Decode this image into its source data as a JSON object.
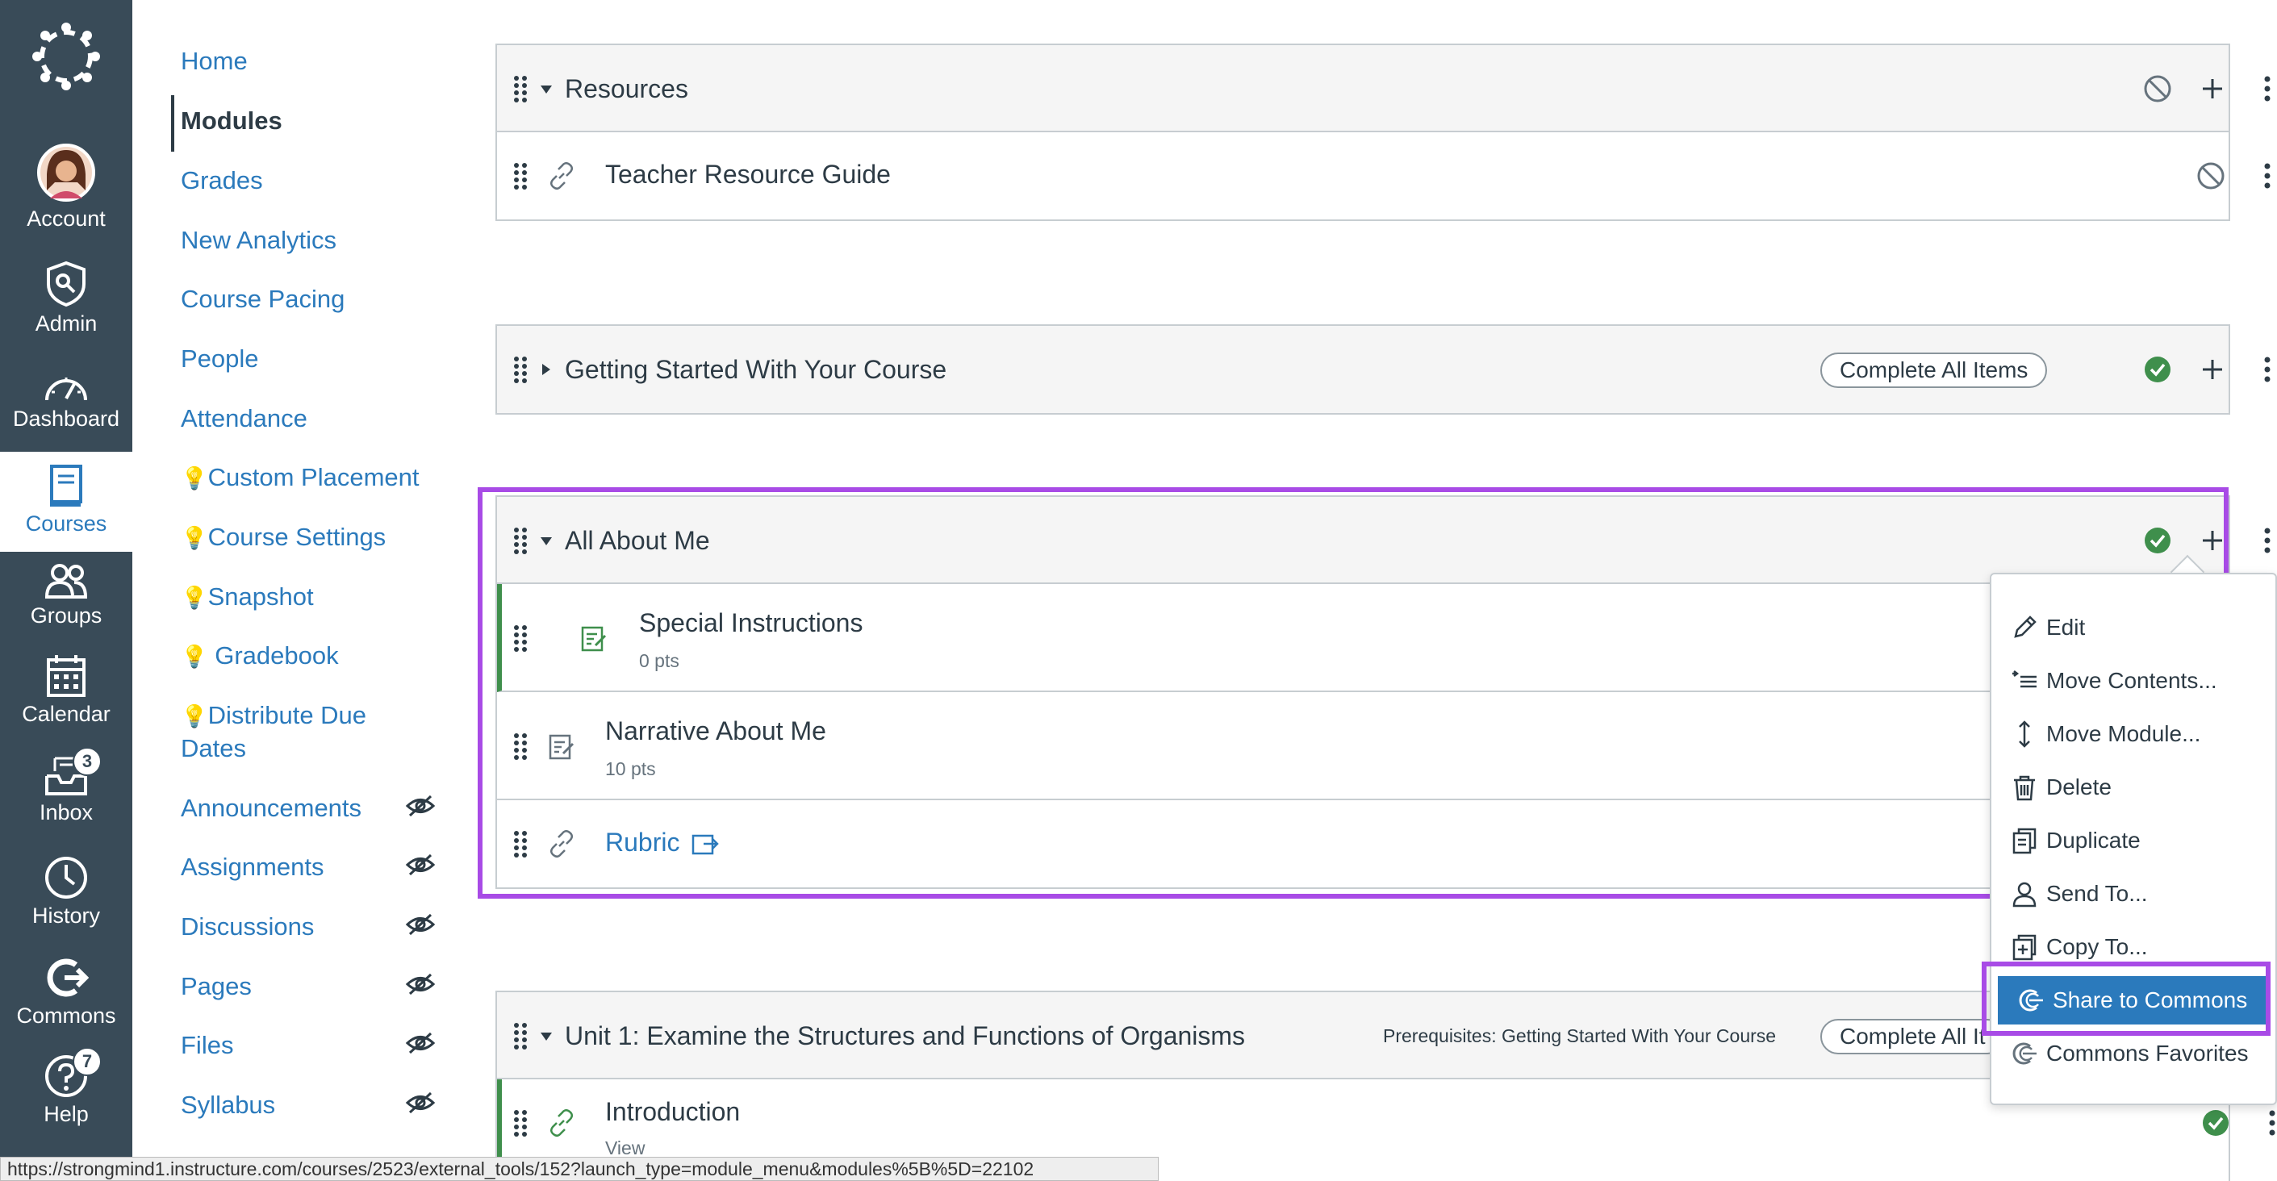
{
  "global_nav": {
    "items": [
      {
        "label": "Account",
        "icon": "avatar"
      },
      {
        "label": "Admin",
        "icon": "shield-icon"
      },
      {
        "label": "Dashboard",
        "icon": "speedometer-icon"
      },
      {
        "label": "Courses",
        "icon": "book-icon"
      },
      {
        "label": "Groups",
        "icon": "users-icon"
      },
      {
        "label": "Calendar",
        "icon": "calendar-icon"
      },
      {
        "label": "Inbox",
        "icon": "inbox-icon",
        "badge": "3"
      },
      {
        "label": "History",
        "icon": "clock-icon"
      },
      {
        "label": "Commons",
        "icon": "commons-icon"
      },
      {
        "label": "Help",
        "icon": "question-icon",
        "badge": "7"
      }
    ]
  },
  "course_nav": {
    "items": [
      {
        "label": "Home"
      },
      {
        "label": "Modules"
      },
      {
        "label": "Grades"
      },
      {
        "label": "New Analytics"
      },
      {
        "label": "Course Pacing"
      },
      {
        "label": "People"
      },
      {
        "label": "Attendance"
      },
      {
        "label": "Custom Placement"
      },
      {
        "label": "Course Settings"
      },
      {
        "label": "Snapshot"
      },
      {
        "label": "Gradebook"
      },
      {
        "label": "Distribute Due"
      },
      {
        "label": "Dates"
      },
      {
        "label": "Announcements"
      },
      {
        "label": "Assignments"
      },
      {
        "label": "Discussions"
      },
      {
        "label": "Pages"
      },
      {
        "label": "Files"
      },
      {
        "label": "Syllabus"
      }
    ]
  },
  "modules": {
    "resources": {
      "title": "Resources",
      "items": [
        {
          "title": "Teacher Resource Guide"
        }
      ]
    },
    "getting_started": {
      "title": "Getting Started With Your Course",
      "complete_label": "Complete All Items"
    },
    "all_about_me": {
      "title": "All About Me",
      "items": [
        {
          "title": "Special Instructions",
          "points": "0 pts"
        },
        {
          "title": "Narrative About Me",
          "points": "10 pts"
        },
        {
          "title": "Rubric"
        }
      ]
    },
    "unit1": {
      "title": "Unit 1: Examine the Structures and Functions of Organisms",
      "prerequisites": "Prerequisites: Getting Started With Your Course",
      "complete_label": "Complete All It",
      "items": [
        {
          "title": "Introduction",
          "sub": "View"
        }
      ]
    }
  },
  "module_menu": {
    "items": [
      {
        "label": "Edit"
      },
      {
        "label": "Move Contents..."
      },
      {
        "label": "Move Module..."
      },
      {
        "label": "Delete"
      },
      {
        "label": "Duplicate"
      },
      {
        "label": "Send To..."
      },
      {
        "label": "Copy To..."
      },
      {
        "label": "Share to Commons"
      },
      {
        "label": "Commons Favorites"
      }
    ]
  },
  "status_bar": {
    "url": "https://strongmind1.instructure.com/courses/2523/external_tools/152?launch_type=module_menu&modules%5B%5D=22102"
  },
  "colors": {
    "nav_bg": "#394b58",
    "link_blue": "#2b7abc",
    "highlight_purple": "#a84be6",
    "complete_green": "#3f8f4c"
  }
}
